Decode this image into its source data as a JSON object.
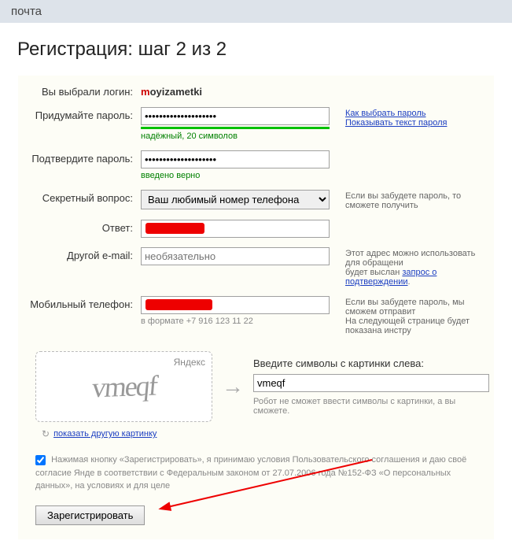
{
  "topbar": {
    "label": "почта"
  },
  "title": "Регистрация: шаг 2 из 2",
  "login": {
    "label": "Вы выбрали логин:",
    "value_first": "m",
    "value_rest": "oyizametki"
  },
  "password": {
    "label": "Придумайте пароль:",
    "value": "••••••••••••••••••••",
    "hint": "надёжный, 20 символов",
    "side1": "Как выбрать пароль",
    "side2": "Показывать текст пароля"
  },
  "confirm": {
    "label": "Подтвердите пароль:",
    "value": "••••••••••••••••••••",
    "hint": "введено верно"
  },
  "question": {
    "label": "Секретный вопрос:",
    "selected": "Ваш любимый номер телефона",
    "side": "Если вы забудете пароль, то сможете получить"
  },
  "answer": {
    "label": "Ответ:"
  },
  "email": {
    "label": "Другой e-mail:",
    "placeholder": "необязательно",
    "side1": "Этот адрес можно использовать для обращени",
    "side2a": "будет выслан ",
    "side2b": "запрос о подтверждении"
  },
  "phone": {
    "label": "Мобильный телефон:",
    "hint": "в формате +7 916 123 11 22",
    "side1": "Если вы забудете пароль, мы сможем отправит",
    "side2": "На следующей странице будет показана инстру"
  },
  "captcha": {
    "brand": "Яндекс",
    "text": "vmeqf",
    "label": "Введите символы с картинки слева:",
    "value": "vmeqf",
    "robot": "Робот не сможет ввести символы с картинки, а вы сможете.",
    "refresh": "показать другую картинку"
  },
  "agreement": {
    "text": "Нажимая кнопку «Зарегистрировать», я принимаю условия Пользовательского соглашения и даю своё согласие Янде в соответствии с Федеральным законом от 27.07.2006 года №152-ФЗ «О персональных данных», на условиях и для целе"
  },
  "submit": {
    "label": "Зарегистрировать"
  }
}
